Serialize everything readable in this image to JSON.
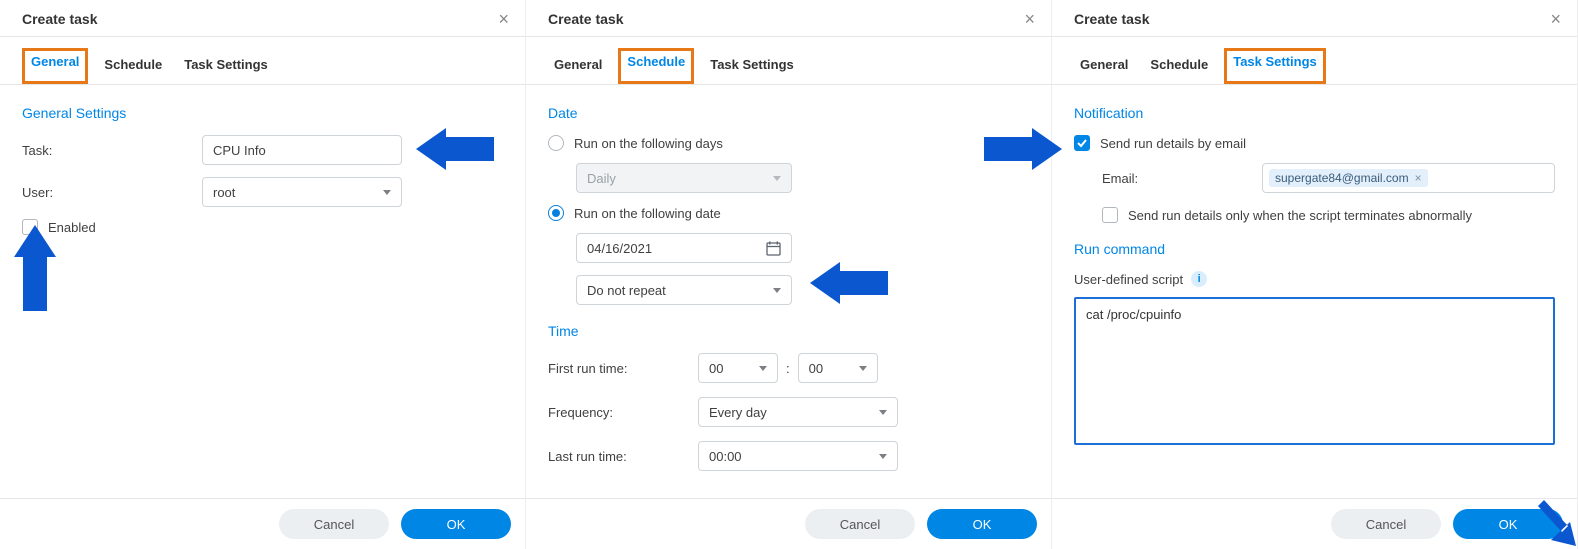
{
  "colors": {
    "accent": "#0086e5",
    "highlight": "#e67817"
  },
  "dialogs": [
    {
      "title": "Create task",
      "active_tab": 0,
      "tabs": [
        "General",
        "Schedule",
        "Task Settings"
      ],
      "highlight_tab": 0,
      "section": "General Settings",
      "task_label": "Task:",
      "task_value": "CPU Info",
      "user_label": "User:",
      "user_value": "root",
      "enabled_label": "Enabled",
      "enabled_checked": false,
      "cancel": "Cancel",
      "ok": "OK"
    },
    {
      "title": "Create task",
      "active_tab": 1,
      "tabs": [
        "General",
        "Schedule",
        "Task Settings"
      ],
      "highlight_tab": 1,
      "date_section": "Date",
      "run_days_label": "Run on the following days",
      "daily_label": "Daily",
      "run_date_label": "Run on the following date",
      "date_value": "04/16/2021",
      "repeat_value": "Do not repeat",
      "time_section": "Time",
      "first_run_label": "First run time:",
      "hour": "00",
      "minute": "00",
      "colon": ":",
      "freq_label": "Frequency:",
      "freq_value": "Every day",
      "last_run_label": "Last run time:",
      "last_run_value": "00:00",
      "cancel": "Cancel",
      "ok": "OK"
    },
    {
      "title": "Create task",
      "active_tab": 2,
      "tabs": [
        "General",
        "Schedule",
        "Task Settings"
      ],
      "highlight_tab": 2,
      "notif_section": "Notification",
      "send_email_label": "Send run details by email",
      "send_email_checked": true,
      "email_label": "Email:",
      "email_value": "supergate84@gmail.com",
      "abnormal_label": "Send run details only when the script terminates abnormally",
      "abnormal_checked": false,
      "run_cmd_section": "Run command",
      "user_script_label": "User-defined script",
      "script_value": "cat /proc/cpuinfo",
      "cancel": "Cancel",
      "ok": "OK"
    }
  ]
}
